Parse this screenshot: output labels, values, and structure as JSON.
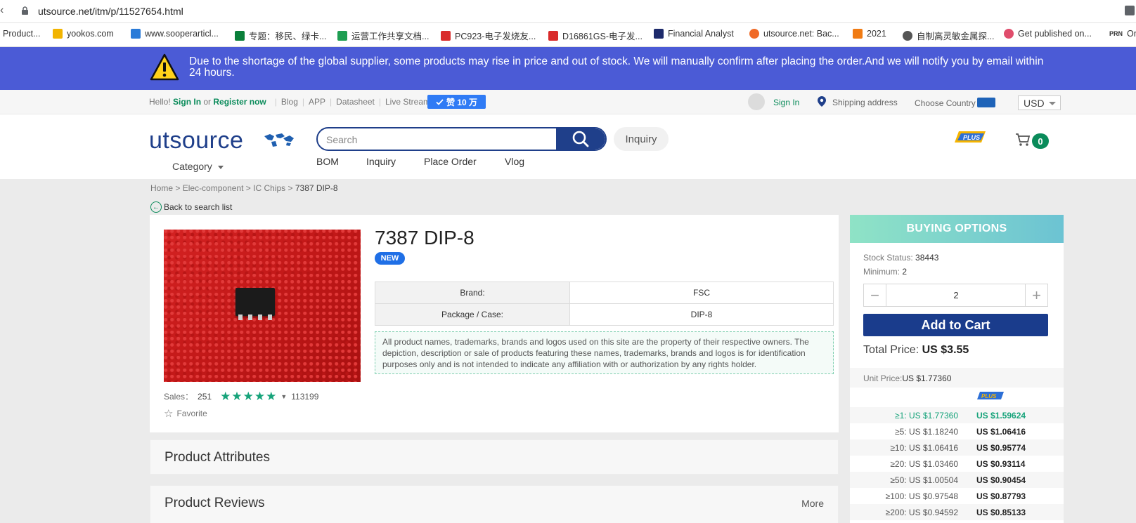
{
  "browser": {
    "url": "utsource.net/itm/p/11527654.html",
    "bookmarks": [
      {
        "label": "Product...",
        "color": "#ffffff"
      },
      {
        "label": "yookos.com",
        "color": "#f2b400"
      },
      {
        "label": "www.sooperarticl...",
        "color": "#2a7bd8"
      },
      {
        "label": "专题：移民、绿卡...",
        "color": "#0a7f3a"
      },
      {
        "label": "运营工作共享文档...",
        "color": "#1e9e52"
      },
      {
        "label": "PC923-电子发烧友...",
        "color": "#d92b2b"
      },
      {
        "label": "D16861GS-电子发...",
        "color": "#d92b2b"
      },
      {
        "label": "Financial Analyst",
        "color": "#1d2a6b"
      },
      {
        "label": "utsource.net: Bac...",
        "color": "#f06a27"
      },
      {
        "label": "2021",
        "color": "#f07b13"
      },
      {
        "label": "自制高灵敏金属探...",
        "color": "#555555"
      },
      {
        "label": "Get published on...",
        "color": "#e04d6c"
      },
      {
        "label": "Or",
        "color": "#222222"
      }
    ],
    "bookmark_prn": "PRN"
  },
  "banner": {
    "message": "Due to the shortage of the global supplier, some products may rise in price and out of stock. We will manually confirm after placing the order.And we will notify you by email within 24 hours."
  },
  "topbar": {
    "hello": "Hello!",
    "sign_in": "Sign In",
    "or": "or",
    "register": "Register now",
    "links": [
      "Blog",
      "APP",
      "Datasheet",
      "Live Stream"
    ],
    "zan": "赞 10 万",
    "account_sign_in": "Sign In",
    "shipping": "Shipping address",
    "choose_country": "Choose Country",
    "currency": "USD"
  },
  "header": {
    "logo": "utsource",
    "category": "Category",
    "search_placeholder": "Search",
    "inquiry": "Inquiry",
    "nav": [
      "BOM",
      "Inquiry",
      "Place Order",
      "Vlog"
    ],
    "cart_count": "0"
  },
  "breadcrumb": {
    "items": [
      "Home",
      "Elec-component",
      "IC Chips"
    ],
    "current": "7387 DIP-8",
    "sep": ">",
    "back": "Back to search list"
  },
  "product": {
    "title": "7387 DIP-8",
    "badge": "NEW",
    "attributes": [
      {
        "k": "Brand:",
        "v": "FSC"
      },
      {
        "k": "Package / Case:",
        "v": "DIP-8"
      }
    ],
    "disclaimer": "All product names, trademarks, brands and logos used on this site are the property of their respective owners. The depiction, description or sale of products featuring these names, trademarks, brands and logos is for identification purposes only and is not intended to indicate any affiliation with or authorization by any rights holder.",
    "sales_label": "Sales：",
    "sales_value": "251",
    "rating": 5,
    "review_count": "113199",
    "favorite": "Favorite"
  },
  "sections": {
    "attributes": "Product Attributes",
    "reviews": "Product Reviews",
    "more": "More"
  },
  "buying": {
    "title": "BUYING OPTIONS",
    "stock_label": "Stock Status:",
    "stock_value": "38443",
    "min_label": "Minimum:",
    "min_value": "2",
    "quantity": "2",
    "add_to_cart": "Add to Cart",
    "total_label": "Total Price:",
    "total_value": "US $3.55",
    "unit_label": "Unit Price:",
    "unit_value": "US $1.77360",
    "tiers": [
      {
        "q": "≥1: US $1.77360",
        "p": "US $1.59624"
      },
      {
        "q": "≥5: US $1.18240",
        "p": "US $1.06416"
      },
      {
        "q": "≥10: US $1.06416",
        "p": "US $0.95774"
      },
      {
        "q": "≥20: US $1.03460",
        "p": "US $0.93114"
      },
      {
        "q": "≥50: US $1.00504",
        "p": "US $0.90454"
      },
      {
        "q": "≥100: US $0.97548",
        "p": "US $0.87793"
      },
      {
        "q": "≥200: US $0.94592",
        "p": "US $0.85133"
      }
    ]
  }
}
